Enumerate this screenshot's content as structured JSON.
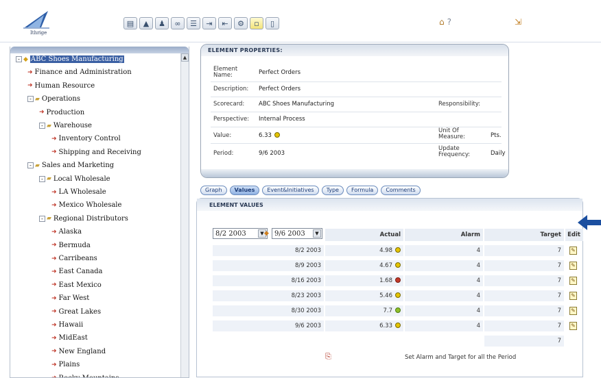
{
  "toolbar": {
    "logo_text": "Ithrige",
    "icons": [
      "report-icon",
      "chart-icon",
      "user-icon",
      "link-icon",
      "list-icon",
      "import-icon",
      "export-icon",
      "settings-icon",
      "note-icon",
      "document-icon"
    ],
    "right_icons": [
      "home-icon",
      "help-icon",
      "exit-icon"
    ]
  },
  "tree": {
    "items": [
      {
        "label": "ABC Shoes Manufacturing",
        "level": 0,
        "type": "root",
        "expander": "-",
        "selected": true
      },
      {
        "label": "Finance and Administration",
        "level": 1,
        "type": "leaf"
      },
      {
        "label": "Human Resource",
        "level": 1,
        "type": "leaf"
      },
      {
        "label": "Operations",
        "level": 1,
        "type": "folder",
        "expander": "-"
      },
      {
        "label": "Production",
        "level": 2,
        "type": "leaf"
      },
      {
        "label": "Warehouse",
        "level": 2,
        "type": "folder",
        "expander": "-"
      },
      {
        "label": "Inventory Control",
        "level": 3,
        "type": "leaf"
      },
      {
        "label": "Shipping and Receiving",
        "level": 3,
        "type": "leaf"
      },
      {
        "label": "Sales and Marketing",
        "level": 1,
        "type": "folder",
        "expander": "-"
      },
      {
        "label": "Local Wholesale",
        "level": 2,
        "type": "folder",
        "expander": "-"
      },
      {
        "label": "LA Wholesale",
        "level": 3,
        "type": "leaf"
      },
      {
        "label": "Mexico Wholesale",
        "level": 3,
        "type": "leaf"
      },
      {
        "label": "Regional Distributors",
        "level": 2,
        "type": "folder",
        "expander": "-"
      },
      {
        "label": "Alaska",
        "level": 3,
        "type": "leaf"
      },
      {
        "label": "Bermuda",
        "level": 3,
        "type": "leaf"
      },
      {
        "label": "Carribeans",
        "level": 3,
        "type": "leaf"
      },
      {
        "label": "East Canada",
        "level": 3,
        "type": "leaf"
      },
      {
        "label": "East Mexico",
        "level": 3,
        "type": "leaf"
      },
      {
        "label": "Far West",
        "level": 3,
        "type": "leaf"
      },
      {
        "label": "Great Lakes",
        "level": 3,
        "type": "leaf"
      },
      {
        "label": "Hawaii",
        "level": 3,
        "type": "leaf"
      },
      {
        "label": "MidEast",
        "level": 3,
        "type": "leaf"
      },
      {
        "label": "New England",
        "level": 3,
        "type": "leaf"
      },
      {
        "label": "Plains",
        "level": 3,
        "type": "leaf"
      },
      {
        "label": "Rocky Mountains",
        "level": 3,
        "type": "leaf"
      }
    ]
  },
  "properties": {
    "title": "ELEMENT PROPERTIES:",
    "element_name_label": "Element Name:",
    "element_name": "Perfect Orders",
    "description_label": "Description:",
    "description": "Perfect Orders",
    "scorecard_label": "Scorecard:",
    "scorecard": "ABC Shoes Manufacturing",
    "responsibility_label": "Responsibility:",
    "perspective_label": "Perspective:",
    "perspective": "Internal Process",
    "value_label": "Value:",
    "value": "6.33",
    "unit_label": "Unit Of Measure:",
    "unit": "Pts.",
    "period_label": "Period:",
    "period": "9/6 2003",
    "frequency_label": "Update Frequency:",
    "frequency": "Daily"
  },
  "tabs": [
    "Graph",
    "Values",
    "Event&Initiatives",
    "Type",
    "Formula",
    "Comments"
  ],
  "active_tab": "Values",
  "values": {
    "title": "ELEMENT VALUES",
    "from_date": "8/2 2003",
    "to_date": "9/6 2003",
    "columns": [
      "Actual",
      "Alarm",
      "Target",
      "Edit"
    ],
    "rows": [
      {
        "date": "8/2 2003",
        "actual": "4.98",
        "status": "yellow",
        "alarm": "4",
        "target": "7"
      },
      {
        "date": "8/9 2003",
        "actual": "4.67",
        "status": "yellow",
        "alarm": "4",
        "target": "7"
      },
      {
        "date": "8/16 2003",
        "actual": "1.68",
        "status": "red",
        "alarm": "4",
        "target": "7"
      },
      {
        "date": "8/23 2003",
        "actual": "5.46",
        "status": "yellow",
        "alarm": "4",
        "target": "7"
      },
      {
        "date": "8/30 2003",
        "actual": "7.7",
        "status": "green",
        "alarm": "4",
        "target": "7"
      },
      {
        "date": "9/6 2003",
        "actual": "6.33",
        "status": "yellow",
        "alarm": "4",
        "target": "7"
      }
    ],
    "extra_target": "7",
    "set_all_label": "Set Alarm and Target for all the Period"
  },
  "colors": {
    "accent": "#3a5fa3",
    "status_yellow": "#e4c400",
    "status_green": "#8fbf2a",
    "status_red": "#c23a2a",
    "arrow": "#1b4fa0"
  }
}
